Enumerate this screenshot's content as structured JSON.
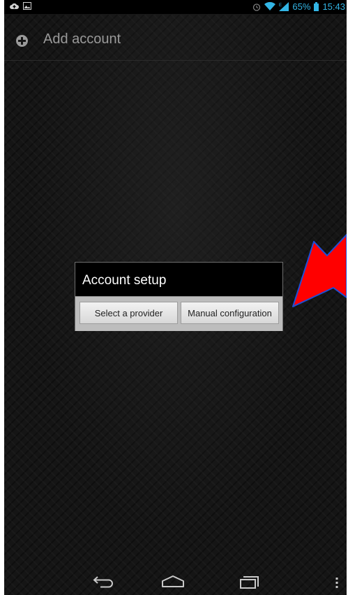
{
  "status_bar": {
    "time": "15:43",
    "battery_percent": "65%",
    "icons": [
      "cloud-upload-icon",
      "image-icon",
      "alarm-icon",
      "wifi-icon",
      "signal-icon",
      "battery-icon"
    ]
  },
  "action_bar": {
    "title": "Add account",
    "icon": "add-circle-icon"
  },
  "dialog": {
    "title": "Account setup",
    "buttons": {
      "select_provider": "Select a provider",
      "manual_configuration": "Manual configuration"
    }
  },
  "annotation": {
    "type": "arrow",
    "color": "#ff0000",
    "border_color": "#1e4fd6"
  },
  "nav_bar": {
    "icons": [
      "back-icon",
      "home-icon",
      "recent-apps-icon",
      "menu-icon"
    ]
  }
}
